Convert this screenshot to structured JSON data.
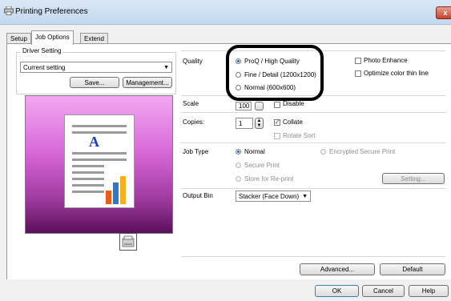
{
  "window": {
    "title": "Printing Preferences",
    "close_label": "x"
  },
  "tabs": [
    {
      "label": "Setup"
    },
    {
      "label": "Job Options"
    },
    {
      "label": "Extend"
    }
  ],
  "driver_setting": {
    "legend": "Driver Setting",
    "value": "Current setting",
    "save_label": "Save...",
    "management_label": "Management..."
  },
  "quality": {
    "label": "Quality",
    "options": [
      "ProQ / High Quality",
      "Fine / Detail (1200x1200)",
      "Normal (600x600)"
    ],
    "photo_enhance": "Photo Enhance",
    "optimize_color": "Optimize color thin line"
  },
  "scale": {
    "label": "Scale",
    "value": "100",
    "disable": "Disable"
  },
  "copies": {
    "label": "Copies:",
    "value": "1",
    "collate": "Collate",
    "rotate_sort": "Rotate Sort"
  },
  "job_type": {
    "label": "Job Type",
    "normal": "Normal",
    "encrypted": "Encrypted Secure Print",
    "secure": "Secure Print",
    "store": "Store for Re-print",
    "setting_label": "Setting..."
  },
  "output_bin": {
    "label": "Output Bin",
    "value": "Stacker (Face Down)"
  },
  "advanced_label": "Advanced...",
  "default_label": "Default",
  "ok_label": "OK",
  "cancel_label": "Cancel",
  "help_label": "Help",
  "preview": {
    "doc_letter": "A"
  },
  "colors": {
    "accent": "#1b5fbf",
    "preview_top": "#f2a8f2",
    "preview_bottom": "#5a105a"
  }
}
